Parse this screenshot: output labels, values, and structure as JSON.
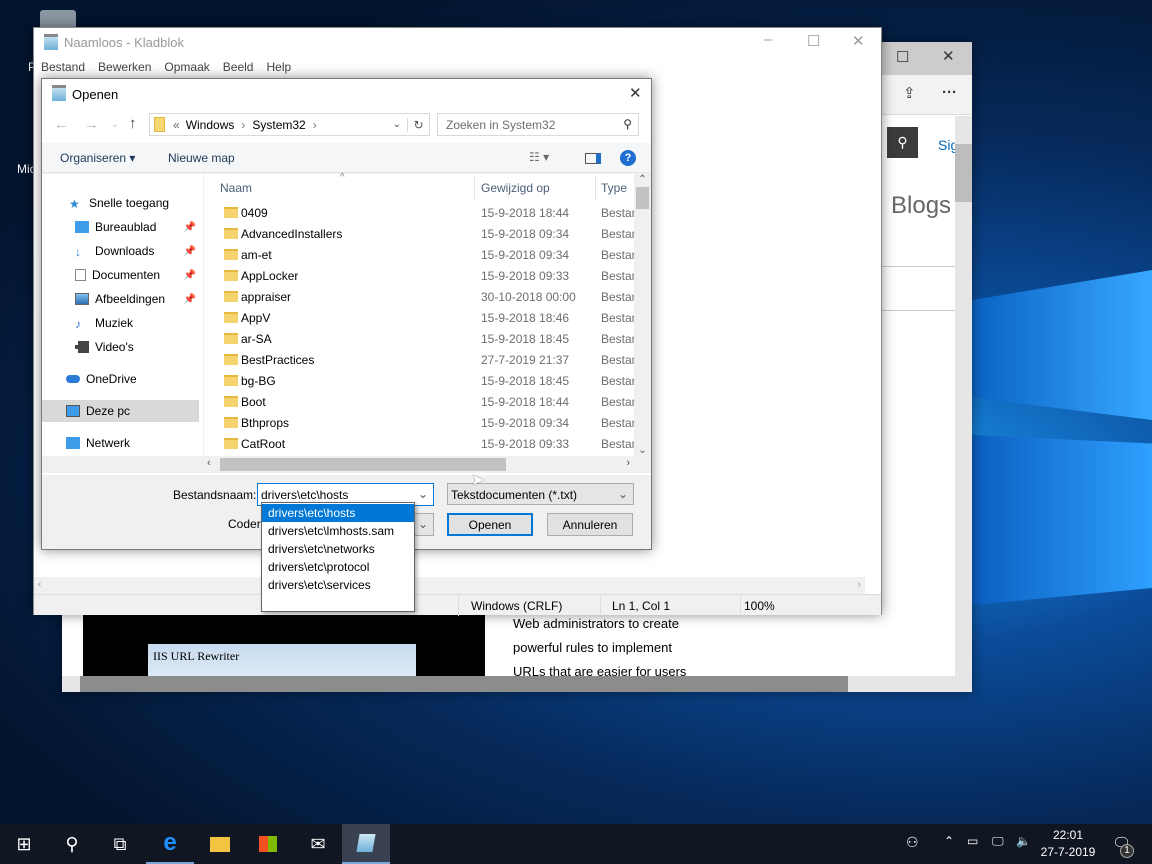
{
  "desktop": {
    "icon_label_partial": "Mic",
    "recycle_label_partial": "P"
  },
  "edge": {
    "more": "···",
    "sign_in_partial": "Sig",
    "blogs": "Blogs",
    "article_lines": [
      "Web administrators to create",
      "powerful rules to implement",
      "URLs that are easier for users"
    ],
    "image_caption": "IIS URL Rewriter"
  },
  "notepad": {
    "title": "Naamloos - Kladblok",
    "menu": [
      "Bestand",
      "Bewerken",
      "Opmaak",
      "Beeld",
      "Help"
    ],
    "status": {
      "eol": "Windows (CRLF)",
      "pos": "Ln 1, Col 1",
      "zoom": "100%"
    }
  },
  "dialog": {
    "title": "Openen",
    "breadcrumb": {
      "prefix": "«",
      "parts": [
        "Windows",
        "System32"
      ]
    },
    "search_placeholder": "Zoeken in System32",
    "toolbar": {
      "organize": "Organiseren",
      "new_folder": "Nieuwe map"
    },
    "nav": [
      {
        "label": "Snelle toegang",
        "icon": "star-icon"
      },
      {
        "label": "Bureaublad",
        "icon": "desktop-icon",
        "pinned": true
      },
      {
        "label": "Downloads",
        "icon": "download-icon",
        "pinned": true
      },
      {
        "label": "Documenten",
        "icon": "document-icon",
        "pinned": true
      },
      {
        "label": "Afbeeldingen",
        "icon": "image-icon",
        "pinned": true
      },
      {
        "label": "Muziek",
        "icon": "music-icon"
      },
      {
        "label": "Video's",
        "icon": "video-icon"
      },
      {
        "label": "OneDrive",
        "icon": "cloud-icon"
      },
      {
        "label": "Deze pc",
        "icon": "computer-icon",
        "selected": true
      },
      {
        "label": "Netwerk",
        "icon": "network-icon"
      }
    ],
    "columns": [
      "Naam",
      "Gewijzigd op",
      "Type"
    ],
    "files": [
      [
        "0409",
        "15-9-2018 18:44",
        "Bestan"
      ],
      [
        "AdvancedInstallers",
        "15-9-2018 09:34",
        "Bestan"
      ],
      [
        "am-et",
        "15-9-2018 09:34",
        "Bestan"
      ],
      [
        "AppLocker",
        "15-9-2018 09:33",
        "Bestan"
      ],
      [
        "appraiser",
        "30-10-2018 00:00",
        "Bestan"
      ],
      [
        "AppV",
        "15-9-2018 18:46",
        "Bestan"
      ],
      [
        "ar-SA",
        "15-9-2018 18:45",
        "Bestan"
      ],
      [
        "BestPractices",
        "27-7-2019 21:37",
        "Bestan"
      ],
      [
        "bg-BG",
        "15-9-2018 18:45",
        "Bestan"
      ],
      [
        "Boot",
        "15-9-2018 18:44",
        "Bestan"
      ],
      [
        "Bthprops",
        "15-9-2018 09:34",
        "Bestan"
      ],
      [
        "CatRoot",
        "15-9-2018 09:33",
        "Bestan"
      ]
    ],
    "filename_label": "Bestandsnaam:",
    "filename_value": "drivers\\etc\\hosts",
    "filter": "Tekstdocumenten (*.txt)",
    "encoding_label_partial": "Coderi",
    "open_button": "Openen",
    "cancel_button": "Annuleren",
    "autocomplete": [
      "drivers\\etc\\hosts",
      "drivers\\etc\\lmhosts.sam",
      "drivers\\etc\\networks",
      "drivers\\etc\\protocol",
      "drivers\\etc\\services"
    ]
  },
  "taskbar": {
    "time": "22:01",
    "date": "27-7-2019",
    "notifications": "1"
  },
  "colors": {
    "accent": "#0078d7",
    "selection": "#cce8ff",
    "taskbar": "#101722"
  }
}
